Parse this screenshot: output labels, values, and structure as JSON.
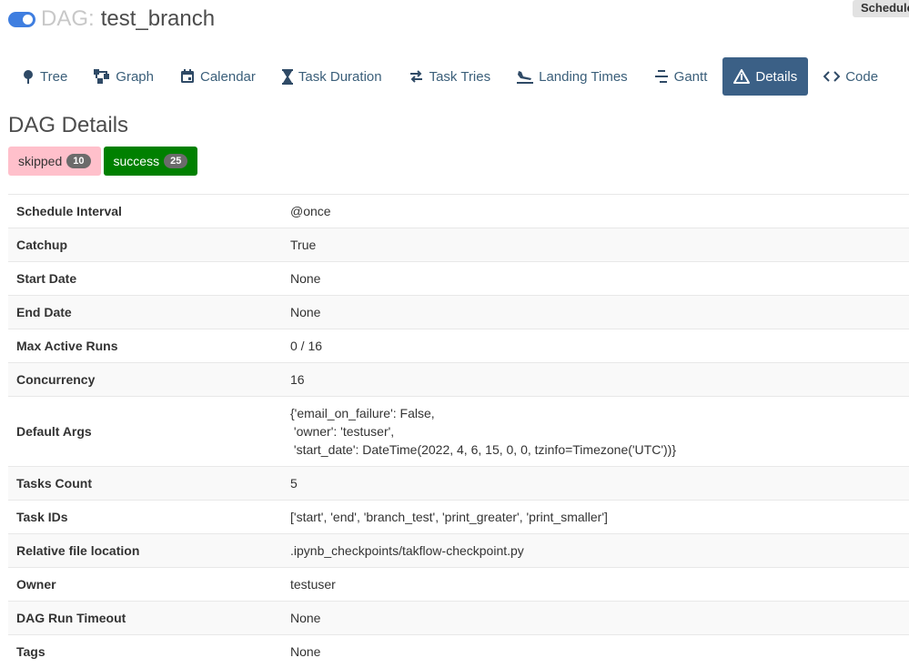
{
  "header": {
    "prefix": "DAG:",
    "dag_id": "test_branch",
    "schedule_badge": "Schedule"
  },
  "nav": {
    "tabs": [
      {
        "label": "Tree",
        "icon": "tree-icon"
      },
      {
        "label": "Graph",
        "icon": "graph-icon"
      },
      {
        "label": "Calendar",
        "icon": "calendar-icon"
      },
      {
        "label": "Task Duration",
        "icon": "hourglass-icon"
      },
      {
        "label": "Task Tries",
        "icon": "retry-icon"
      },
      {
        "label": "Landing Times",
        "icon": "plane-landing-icon"
      },
      {
        "label": "Gantt",
        "icon": "gantt-icon"
      },
      {
        "label": "Details",
        "icon": "warning-triangle-icon",
        "active": true
      },
      {
        "label": "Code",
        "icon": "code-icon"
      }
    ]
  },
  "page": {
    "title": "DAG Details"
  },
  "states": [
    {
      "label": "skipped",
      "count": "10",
      "color": "#ffc0cb"
    },
    {
      "label": "success",
      "count": "25",
      "color": "#008000"
    }
  ],
  "details": [
    {
      "key": "Schedule Interval",
      "value": "@once"
    },
    {
      "key": "Catchup",
      "value": "True"
    },
    {
      "key": "Start Date",
      "value": "None"
    },
    {
      "key": "End Date",
      "value": "None"
    },
    {
      "key": "Max Active Runs",
      "value": "0 / 16"
    },
    {
      "key": "Concurrency",
      "value": "16"
    },
    {
      "key": "Default Args",
      "value": "{'email_on_failure': False,\n 'owner': 'testuser',\n 'start_date': DateTime(2022, 4, 6, 15, 0, 0, tzinfo=Timezone('UTC'))}"
    },
    {
      "key": "Tasks Count",
      "value": "5"
    },
    {
      "key": "Task IDs",
      "value": "['start', 'end', 'branch_test', 'print_greater', 'print_smaller']"
    },
    {
      "key": "Relative file location",
      "value": ".ipynb_checkpoints/takflow-checkpoint.py"
    },
    {
      "key": "Owner",
      "value": "testuser"
    },
    {
      "key": "DAG Run Timeout",
      "value": "None"
    },
    {
      "key": "Tags",
      "value": "None"
    }
  ]
}
